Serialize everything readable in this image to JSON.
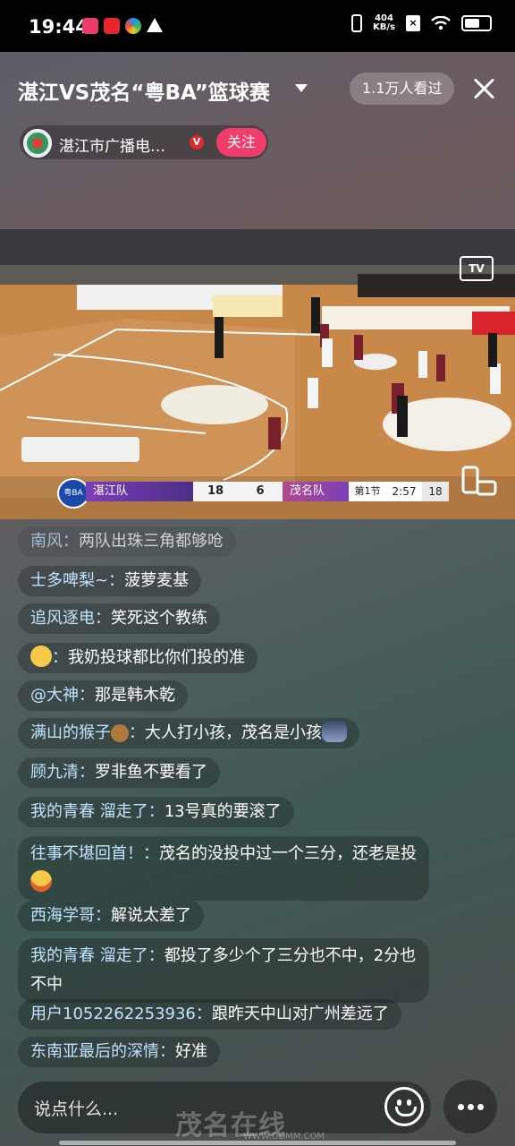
{
  "status_bar": {
    "time": "19:44",
    "net_speed_value": "404",
    "net_speed_unit": "KB/s"
  },
  "header": {
    "title": "湛江VS茂名“粤BA”篮球赛",
    "viewers": "1.1万人看过"
  },
  "channel": {
    "name": "湛江市广播电…",
    "follow_label": "关注"
  },
  "video": {
    "tv_label": "TV",
    "scoreboard": {
      "home_team": "湛江队",
      "home_score": "18",
      "away_score": "6",
      "away_team": "茂名队",
      "period": "第1节",
      "clock": "2:57",
      "shot_clock": "18"
    }
  },
  "comments": [
    {
      "user": "南风",
      "text": "两队出珠三角都够呛"
    },
    {
      "user": "士多啤梨~",
      "text": "菠萝麦基"
    },
    {
      "user": "追风逐电",
      "text": "笑死这个教练"
    },
    {
      "user": "",
      "text": "我奶投球都比你们投的准"
    },
    {
      "user": "@大神",
      "text": "那是韩木乾"
    },
    {
      "user": "满山的猴子",
      "text": "大人打小孩，茂名是小孩"
    },
    {
      "user": "顾九清",
      "text": "罗非鱼不要看了"
    },
    {
      "user": "我的青春 溜走了",
      "text": "13号真的要滚了"
    },
    {
      "user": "往事不堪回首！",
      "text": "茂名的没投中过一个三分，还老是投"
    },
    {
      "user": "西海学哥",
      "text": "解说太差了"
    },
    {
      "user": "我的青春 溜走了",
      "text": "都投了多少个了三分也不中，2分也不中"
    },
    {
      "user": "用户1052262253936",
      "text": "跟昨天中山对广州差远了"
    },
    {
      "user": "东南亚最后的深情",
      "text": "好准"
    }
  ],
  "input": {
    "placeholder": "说点什么..."
  },
  "watermark": {
    "text": "茂名在线",
    "url": "WWW.GDMM.COM"
  }
}
